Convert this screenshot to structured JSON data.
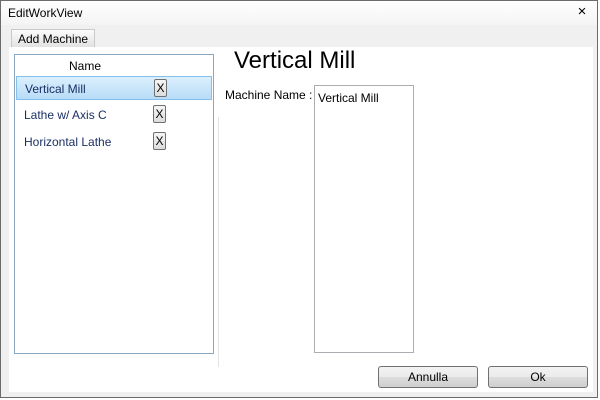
{
  "window": {
    "title": "EditWorkView",
    "close_symbol": "×"
  },
  "menu": {
    "add_machine": "Add Machine"
  },
  "list": {
    "header": "Name",
    "items": [
      {
        "label": "Vertical Mill",
        "remove": "X",
        "selected": true
      },
      {
        "label": "Lathe w/ Axis C",
        "remove": "X",
        "selected": false
      },
      {
        "label": "Horizontal Lathe",
        "remove": "X",
        "selected": false
      }
    ]
  },
  "detail": {
    "title": "Vertical Mill",
    "machine_name_label": "Machine Name :",
    "machine_name_value": "Vertical Mill"
  },
  "buttons": {
    "cancel": "Annulla",
    "ok": "Ok"
  },
  "icons": {
    "close": "close-icon",
    "remove": "remove-icon"
  },
  "colors": {
    "selection": "#b7dcf7",
    "text_item": "#1a2f64",
    "panel_border": "#89a7c2"
  }
}
